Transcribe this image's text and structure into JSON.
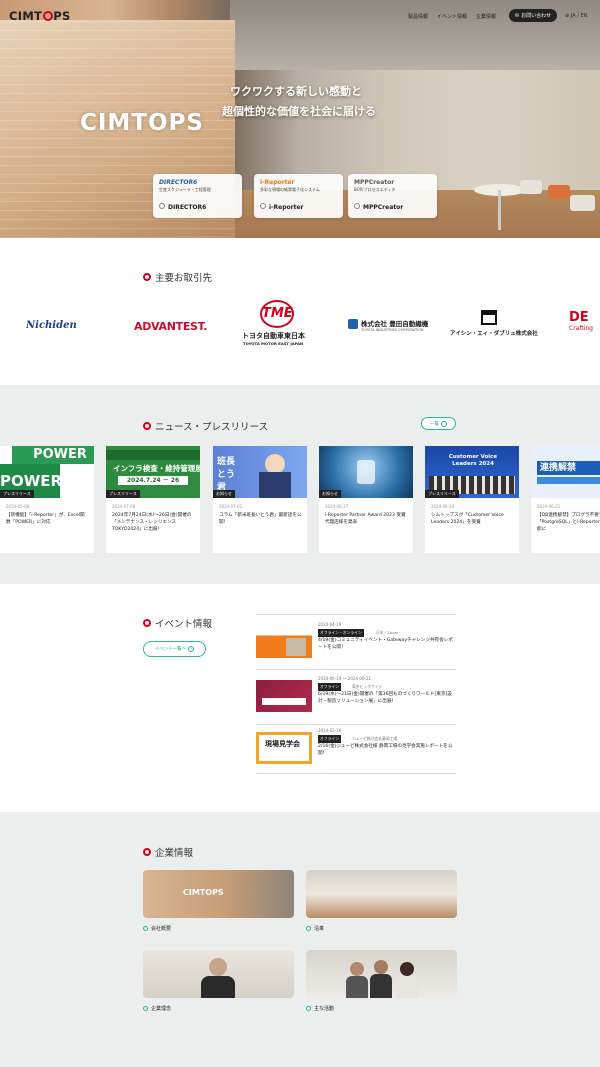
{
  "header": {
    "logo": "CIMTOPS",
    "nav": [
      "製品情報",
      "イベント情報",
      "企業情報"
    ],
    "contact": "お問い合わせ",
    "lang": "JA / EN"
  },
  "hero": {
    "brand": "CIMTOPS",
    "tagline1": "ワクワクする新しい感動と",
    "tagline2": "超個性的な価値を社会に届ける",
    "products": [
      {
        "logo": "DIRECTOR6",
        "sub": "生産スケジューラ・工程管理",
        "name": "DIRECTOR6"
      },
      {
        "logo": "i-Reporter",
        "sub": "多彩な現場の帳票電子化システム",
        "name": "i-Reporter"
      },
      {
        "logo": "MPPCreator",
        "sub": "BOP/プロセスエディタ",
        "name": "MPPCreator"
      }
    ]
  },
  "clients": {
    "title": "主要お取引先",
    "logos": [
      "Nichiden",
      "ADVANTEST.",
      "トヨタ自動車東日本",
      "株式会社 豊田自動織機",
      "アイシン・エィ・ダブリュ株式会社",
      "DE"
    ],
    "sub": {
      "toyota": "TOYOTA MOTOR EAST JAPAN",
      "toyoda": "TOYOTA INDUSTRIES CORPORATION",
      "de": "Crafting"
    }
  },
  "news": {
    "title": "ニュース・プレスリリース",
    "more": "一覧",
    "items": [
      {
        "cat": "プレスリリース",
        "date": "2024-05-08",
        "title": "【新機能】「i-Reporter」が、Excel関数「POWER」に対応",
        "img": "POWER 対応"
      },
      {
        "cat": "プレスリリース",
        "date": "2024-07-08",
        "title": "2024年7月24日(水)～26日(金)開催の「メンテナンス・レジリエンス TOKYO2024」に出展！",
        "img": "インフラ検査・維持管理展"
      },
      {
        "cat": "お知らせ",
        "date": "2024-07-01",
        "title": "コラム「新米班長いとう君」最新話を公開！",
        "img": "班長 とう君"
      },
      {
        "cat": "お知らせ",
        "date": "2024-06-27",
        "title": "i-Reporter Partner Award 2023 受賞代理店様を発表",
        "img": ""
      },
      {
        "cat": "プレスリリース",
        "date": "2024-06-24",
        "title": "シムトップスが「Customer Voice Leaders 2024」を受賞",
        "img": "Customer Voice Leaders 2024"
      },
      {
        "cat": "プレスリリース",
        "date": "2024-06-21",
        "title": "【DB連携解禁】プログラ不要で「PostgreSQL」とi-Reporter」が連携可能に",
        "img": "連携解禁"
      }
    ]
  },
  "events": {
    "title": "イベント情報",
    "more": "イベント一覧へ",
    "items": [
      {
        "date": "2024-04-19",
        "tag": "オフライン・オンライン",
        "loc": "日本／Zoom",
        "title": "4/19(金)コミュニティイベント・Gatewayチャレンジ共有会レポートを公開！"
      },
      {
        "date": "2024-06-19 〜 2024-06-21",
        "tag": "オフライン",
        "loc": "東京ビッグサイト",
        "title": "6/19(水)～21日(金)開催の「第36回ものづくりワールド[東京]設計・製造ソリューション展」に出展！"
      },
      {
        "date": "2024-02-16",
        "tag": "オフライン",
        "loc": "ジューピ株式会社静岡工場",
        "title": "2/16(金)ジューピ株式会社様 静岡工場の見学会実施レポートを公開！"
      }
    ]
  },
  "company": {
    "title": "企業情報",
    "items": [
      "会社概要",
      "沿革",
      "企業理念",
      "主な活動"
    ]
  }
}
